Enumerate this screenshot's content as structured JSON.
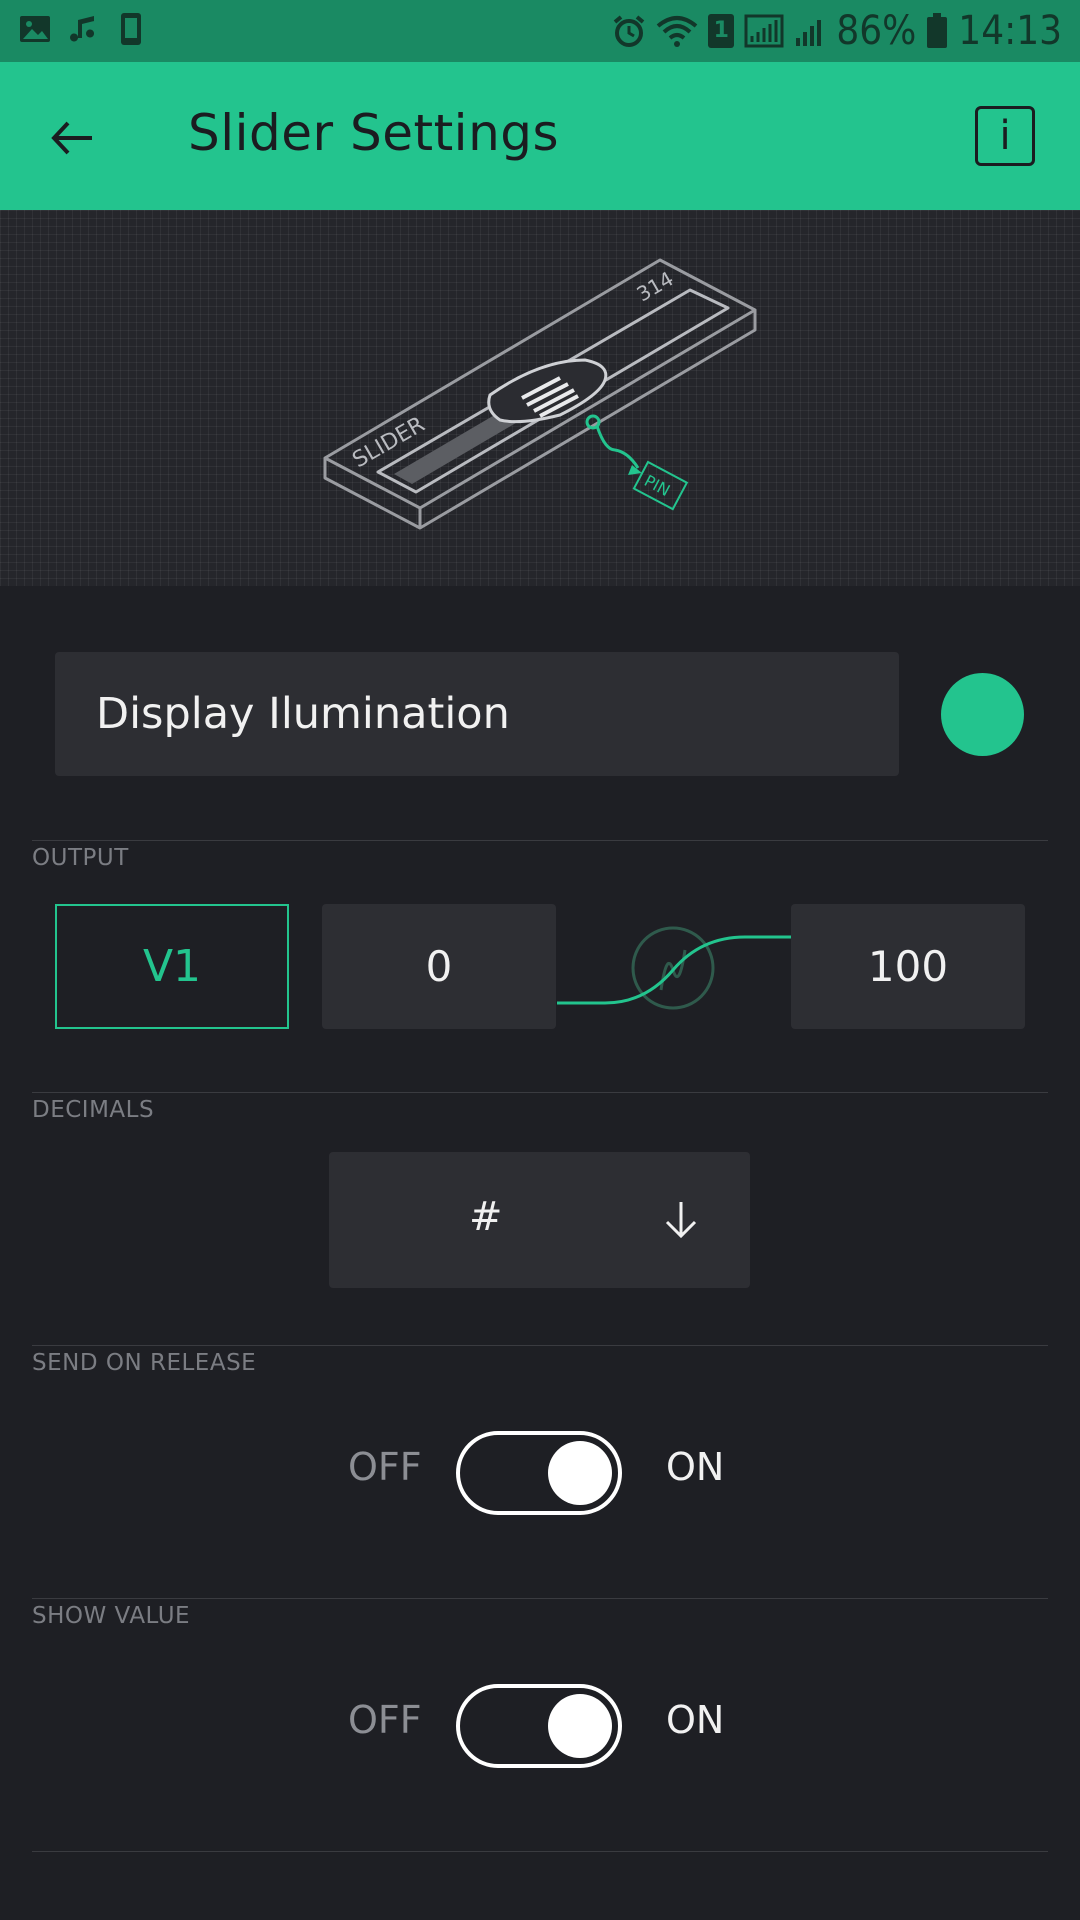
{
  "status_bar": {
    "battery": "86%",
    "time": "14:13",
    "sim_badge": "1"
  },
  "app_bar": {
    "title": "Slider Settings",
    "info_label": "i"
  },
  "hero": {
    "slider_text": "SLIDER",
    "value_text": "314",
    "pin_text": "PIN"
  },
  "widget": {
    "name": "Display Ilumination",
    "color": "#23c48e"
  },
  "output": {
    "label": "OUTPUT",
    "pin": "V1",
    "min": "0",
    "max": "100"
  },
  "decimals": {
    "label": "DECIMALS",
    "value": "#"
  },
  "send_on_release": {
    "label": "SEND ON RELEASE",
    "off_label": "OFF",
    "on_label": "ON",
    "state": "on"
  },
  "show_value": {
    "label": "SHOW VALUE",
    "off_label": "OFF",
    "on_label": "ON",
    "state": "on"
  },
  "accent_color": "#23c48e"
}
